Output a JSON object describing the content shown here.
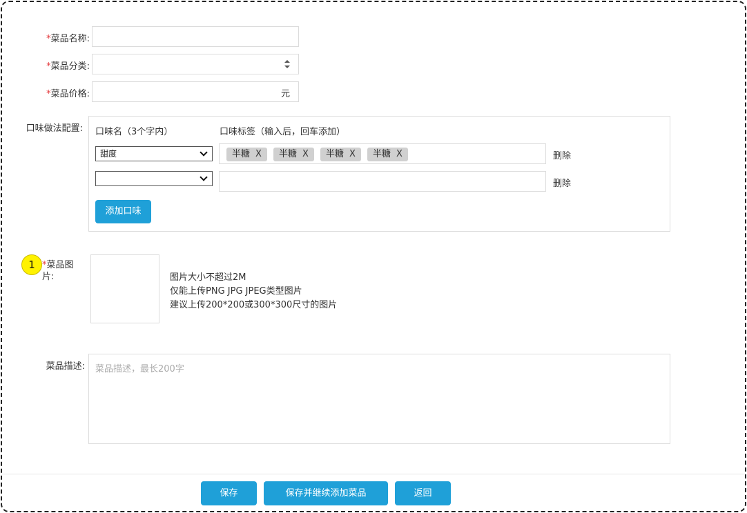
{
  "form": {
    "name": {
      "required_mark": "*",
      "label": "菜品名称:",
      "value": ""
    },
    "category": {
      "required_mark": "*",
      "label": "菜品分类:",
      "value": ""
    },
    "price": {
      "required_mark": "*",
      "label": "菜品价格:",
      "value": "",
      "unit": "元"
    },
    "flavor": {
      "label": "口味做法配置:",
      "col_name_header": "口味名（3个字内）",
      "col_tags_header": "口味标签（输入后，回车添加）",
      "rows": [
        {
          "name": "甜度",
          "tags": [
            {
              "text": "半糖",
              "close": "X"
            },
            {
              "text": "半糖",
              "close": "X"
            },
            {
              "text": "半糖",
              "close": "X"
            },
            {
              "text": "半糖",
              "close": "X"
            }
          ],
          "delete_label": "删除"
        },
        {
          "name": "",
          "tags": [],
          "delete_label": "删除"
        }
      ],
      "add_button": "添加口味"
    },
    "image": {
      "marker": "1",
      "required_mark": "*",
      "label_line1": "菜品图",
      "label_line2": "片:",
      "hints": [
        "图片大小不超过2M",
        "仅能上传PNG JPG JPEG类型图片",
        "建议上传200*200或300*300尺寸的图片"
      ]
    },
    "description": {
      "label": "菜品描述:",
      "placeholder": "菜品描述，最长200字"
    }
  },
  "footer": {
    "save": "保存",
    "save_and_continue": "保存并继续添加菜品",
    "back": "返回"
  },
  "colors": {
    "primary": "#1fa0d8",
    "required": "#e4393c",
    "marker": "#fff200"
  }
}
